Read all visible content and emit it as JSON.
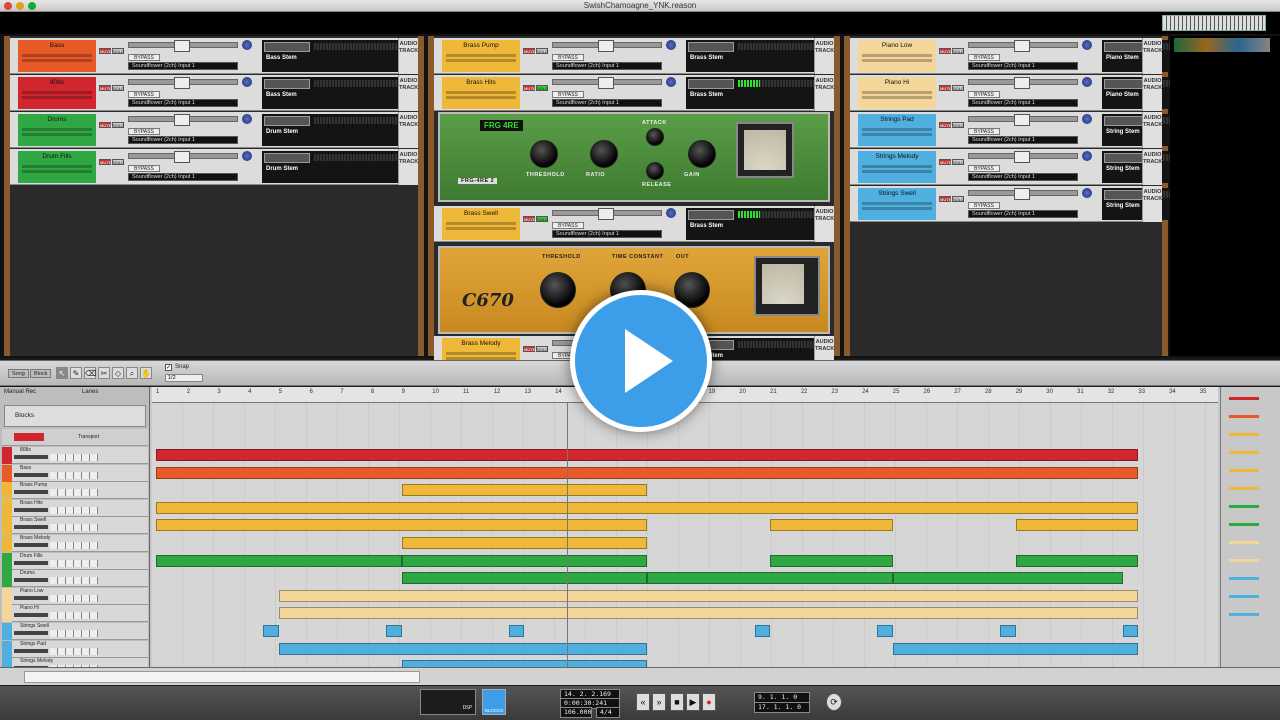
{
  "window": {
    "title": "SwishChamoagne_YNK.reason"
  },
  "rack": {
    "columns": [
      {
        "tracks": [
          {
            "name": "Bass",
            "color": "#e85a28",
            "input": "Soundflower (2ch) Input 1",
            "stem": "Bass Stem"
          },
          {
            "name": "808s",
            "color": "#d2262e",
            "input": "Soundflower (2ch) Input 1",
            "stem": "Bass Stem"
          },
          {
            "name": "Drums",
            "color": "#2fa844",
            "input": "Soundflower (2ch) Input 1",
            "stem": "Drum Stem"
          },
          {
            "name": "Drum Fills",
            "color": "#2fa844",
            "input": "Soundflower (2ch) Input 1",
            "stem": "Drum Stem"
          }
        ]
      },
      {
        "tracks": [
          {
            "name": "Brass Pump",
            "color": "#f0b838",
            "input": "Soundflower (2ch) Input 1",
            "stem": "Brass Stem"
          },
          {
            "name": "Brass Hits",
            "color": "#f0b838",
            "input": "Soundflower (2ch) Input 1",
            "stem": "Brass Stem"
          },
          {
            "name": "Brass Swell",
            "color": "#f0b838",
            "input": "Soundflower (2ch) Input 1",
            "stem": "Brass Stem"
          },
          {
            "name": "Brass Melody",
            "color": "#f0b838",
            "input": "Soundflower (2ch) Input 1",
            "stem": "Brass Stem"
          }
        ]
      },
      {
        "tracks": [
          {
            "name": "Piano Low",
            "color": "#f4d69a",
            "input": "Soundflower (2ch) Input 1",
            "stem": "Piano Stem"
          },
          {
            "name": "Piano Hi",
            "color": "#f4d69a",
            "input": "Soundflower (2ch) Input 1",
            "stem": "Piano Stem"
          },
          {
            "name": "Strings Pad",
            "color": "#4fb0e0",
            "input": "Soundflower (2ch) Input 1",
            "stem": "String Stem"
          },
          {
            "name": "Strings Melody",
            "color": "#4fb0e0",
            "input": "Soundflower (2ch) Input 1",
            "stem": "String Stem"
          },
          {
            "name": "Strings Swell",
            "color": "#4fb0e0",
            "input": "Soundflower (2ch) Input 1",
            "stem": "String Stem"
          }
        ]
      }
    ],
    "common": {
      "mute": "MUTE",
      "solo": "SOLO",
      "bypass": "BYPASS",
      "audio_track": "AUDIO TRACK"
    },
    "frg": {
      "brand": "FRG",
      "brand_suffix": "4RE",
      "model": "FRG-4RE 2",
      "threshold": "THRESHOLD",
      "ratio": "RATIO",
      "attack": "ATTACK",
      "release": "RELEASE",
      "gain": "GAIN"
    },
    "c670": {
      "logo": "C670",
      "threshold": "THRESHOLD",
      "time_constant": "TIME CONSTANT",
      "out": "OUT"
    }
  },
  "toolbar": {
    "song": "Song",
    "block": "Block",
    "snap_label": "Snap",
    "snap_value": "1/2"
  },
  "sequencer": {
    "manual_rec": "Manual Rec",
    "lanes": "Lanes",
    "blocks_label": "Blocks",
    "transport_label": "Transport",
    "tracks": [
      {
        "name": "808s",
        "color": "#d2262e"
      },
      {
        "name": "Bass",
        "color": "#e85a28"
      },
      {
        "name": "Brass Pump",
        "color": "#f0b838"
      },
      {
        "name": "Brass Hits",
        "color": "#f0b838"
      },
      {
        "name": "Brass Swell",
        "color": "#f0b838"
      },
      {
        "name": "Brass Melody",
        "color": "#f0b838"
      },
      {
        "name": "Drum Fills",
        "color": "#2fa844"
      },
      {
        "name": "Drums",
        "color": "#2fa844"
      },
      {
        "name": "Piano Low",
        "color": "#f4d69a"
      },
      {
        "name": "Piano Hi",
        "color": "#f4d69a"
      },
      {
        "name": "Strings Swell",
        "color": "#4fb0e0"
      },
      {
        "name": "Strings Pad",
        "color": "#4fb0e0"
      },
      {
        "name": "Strings Melody",
        "color": "#4fb0e0"
      }
    ],
    "ruler": [
      "1",
      "2",
      "3",
      "4",
      "5",
      "6",
      "7",
      "8",
      "9",
      "10",
      "11",
      "12",
      "13",
      "14",
      "15",
      "16",
      "17",
      "18",
      "19",
      "20",
      "21",
      "22",
      "23",
      "24",
      "25",
      "26",
      "27",
      "28",
      "29",
      "30",
      "31",
      "32",
      "33",
      "34",
      "35"
    ]
  },
  "transport": {
    "position": "14. 2. 2.169",
    "time": "0:00:30:241",
    "tempo": "106.000",
    "signature": "4/4",
    "loop_left": "9. 1. 1. 0",
    "loop_right": "17. 1. 1. 0",
    "blocks_btn": "BLOCKS",
    "dsp": "DSP"
  }
}
